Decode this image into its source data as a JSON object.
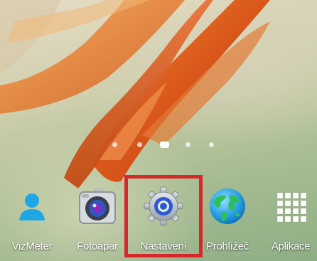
{
  "home_screen": {
    "page_indicator": {
      "pages": 5,
      "active_index": 2
    },
    "dock": [
      {
        "label": "VizMeter",
        "icon": "person-icon"
      },
      {
        "label": "Fotoapar",
        "icon": "camera-icon"
      },
      {
        "label": "Nastavení",
        "icon": "gear-icon"
      },
      {
        "label": "Prohlížeč",
        "icon": "globe-icon"
      },
      {
        "label": "Aplikace",
        "icon": "app-grid-icon"
      }
    ]
  },
  "colors": {
    "highlight_border": "#d9262c",
    "petal_orange": "#e06a1c",
    "person_blue": "#1ea7e4"
  }
}
